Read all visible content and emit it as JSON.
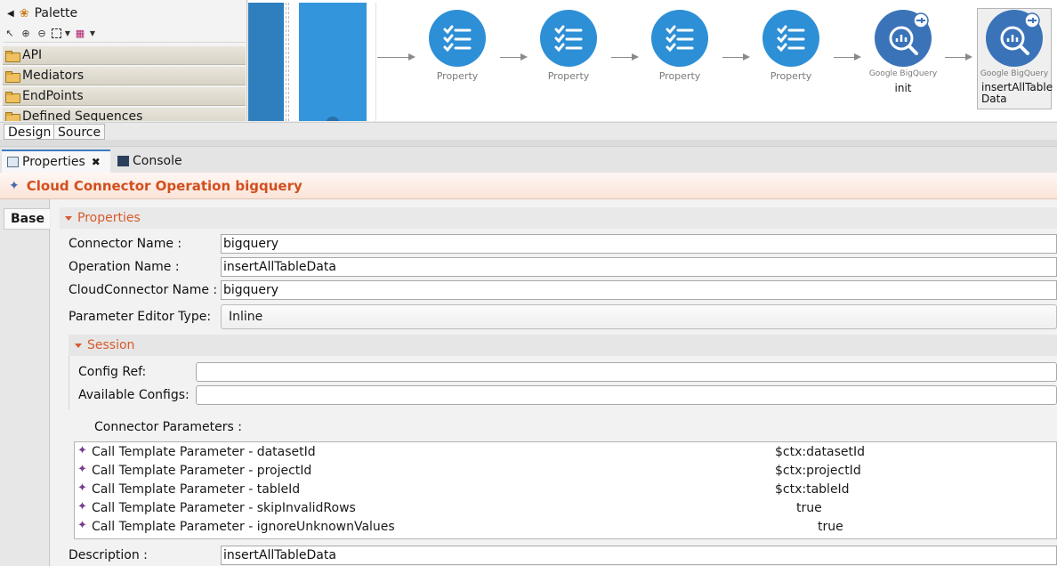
{
  "palette": {
    "title": "Palette",
    "drawers": [
      {
        "label": "API"
      },
      {
        "label": "Mediators"
      },
      {
        "label": "EndPoints"
      },
      {
        "label": "Defined Sequences"
      }
    ]
  },
  "canvas": {
    "nodes": [
      {
        "label": "Property"
      },
      {
        "label": "Property"
      },
      {
        "label": "Property"
      },
      {
        "label": "Property"
      },
      {
        "sub": "Google BigQuery",
        "name": "init"
      },
      {
        "sub": "Google BigQuery",
        "name": "insertAllTable Data"
      }
    ]
  },
  "editor_tabs": {
    "design": "Design",
    "source": "Source"
  },
  "views": {
    "properties": "Properties",
    "console": "Console"
  },
  "title": "Cloud Connector Operation bigquery",
  "side_tab": "Base",
  "properties": {
    "section": "Properties",
    "connector_name_label": "Connector Name :",
    "connector_name": "bigquery",
    "operation_name_label": "Operation Name :",
    "operation_name": "insertAllTableData",
    "cloudconnector_name_label": "CloudConnector Name :",
    "cloudconnector_name": "bigquery",
    "param_editor_label": "Parameter Editor Type:",
    "param_editor_value": "Inline",
    "session": {
      "section": "Session",
      "config_ref_label": "Config Ref:",
      "config_ref": "",
      "available_configs_label": "Available Configs:",
      "available_configs": ""
    },
    "connector_params_label": "Connector Parameters :",
    "params": [
      {
        "name": "Call Template Parameter  -  datasetId",
        "value": "$ctx:datasetId"
      },
      {
        "name": "Call Template Parameter  -  projectId",
        "value": "$ctx:projectId"
      },
      {
        "name": "Call Template Parameter  -  tableId",
        "value": "$ctx:tableId"
      },
      {
        "name": "Call Template Parameter  -  skipInvalidRows",
        "value": "true"
      },
      {
        "name": "Call Template Parameter  -  ignoreUnknownValues",
        "value": "true"
      }
    ],
    "description_label": "Description :",
    "description": "insertAllTableData"
  }
}
